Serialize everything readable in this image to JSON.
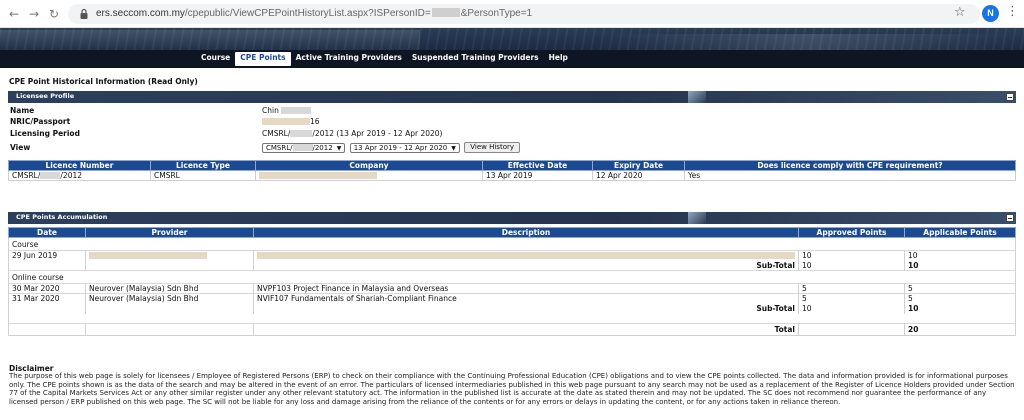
{
  "browser": {
    "url_host": "ers.seccom.com.my",
    "url_path": "/cpepublic/ViewCPEPointHistoryList.aspx?ISPersonID=",
    "url_suffix": "&PersonType=1",
    "profile_initial": "N"
  },
  "menu": [
    {
      "label": "Course",
      "active": false
    },
    {
      "label": "CPE Points",
      "active": true
    },
    {
      "label": "Active Training Providers",
      "active": false
    },
    {
      "label": "Suspended Training Providers",
      "active": false
    },
    {
      "label": "Help",
      "active": false
    }
  ],
  "page_title": "CPE Point Historical Information (Read Only)",
  "licence_profile": {
    "section_label": "Licensee Profile",
    "name_label": "Name",
    "name_value": "Chin",
    "nric_label": "NRIC/Passport",
    "nric_value": "16",
    "period_label": "Licensing Period",
    "period_prefix": "CMSRL/",
    "period_suffix": "/2012 (13 Apr 2019 - 12 Apr 2020)",
    "view_label": "View",
    "view_select_prefix": "CMSRL/",
    "view_select_suffix": "/2012",
    "period_select": "13 Apr 2019 - 12 Apr 2020",
    "view_history_button": "View History",
    "table": {
      "headers": [
        "Licence Number",
        "Licence Type",
        "Company",
        "Effective Date",
        "Expiry Date",
        "Does licence comply with CPE requirement?"
      ],
      "row": {
        "licence_prefix": "CMSRL/",
        "licence_suffix": "/2012",
        "type": "CMSRL",
        "effective": "13 Apr 2019",
        "expiry": "12 Apr 2020",
        "comply": "Yes"
      }
    }
  },
  "accumulation": {
    "section_label": "CPE Points Accumulation",
    "headers": [
      "Date",
      "Provider",
      "Description",
      "Approved Points",
      "Applicable Points"
    ],
    "groups": [
      {
        "name": "Course",
        "rows": [
          {
            "date": "29 Jun 2019",
            "provider": "",
            "description": "",
            "approved": "10",
            "applicable": "10"
          }
        ],
        "subtotal_label": "Sub-Total",
        "subtotal_approved": "10",
        "subtotal_applicable": "10"
      },
      {
        "name": "Online course",
        "rows": [
          {
            "date": "30 Mar 2020",
            "provider": "Neurover (Malaysia) Sdn Bhd",
            "description": "NVPF103 Project Finance in Malaysia and Overseas",
            "approved": "5",
            "applicable": "5"
          },
          {
            "date": "31 Mar 2020",
            "provider": "Neurover (Malaysia) Sdn Bhd",
            "description": "NVIF107 Fundamentals of Shariah-Compliant Finance",
            "approved": "5",
            "applicable": "5"
          }
        ],
        "subtotal_label": "Sub-Total",
        "subtotal_approved": "10",
        "subtotal_applicable": "10"
      }
    ],
    "total_label": "Total",
    "total_applicable": "20"
  },
  "disclaimer": {
    "title": "Disclaimer",
    "text": "The purpose of this web page is solely for licensees / Employee of Registered Persons (ERP) to check on their compliance with the Continuing Professional Education (CPE) obligations and to view the CPE points collected. The data and information provided is for informational purposes only. The CPE points shown is as the data of the search and may be altered in the event of an error. The particulars of licensed intermediaries published in this web page pursuant to any search may not be used as a replacement of the Register of Licence Holders provided under Section 77 of the Capital Markets Services Act or any other similar register under any other relevant statutory act. The information in the published list is accurate at the date as stated therein and may not be updated. The SC does not recommend nor guarantee the performance of any licensed person / ERP published on this web page. The SC will not be liable for any loss and damage arising from the reliance of the contents or for any errors or delays in updating the content, or for any actions taken in reliance thereon."
  }
}
